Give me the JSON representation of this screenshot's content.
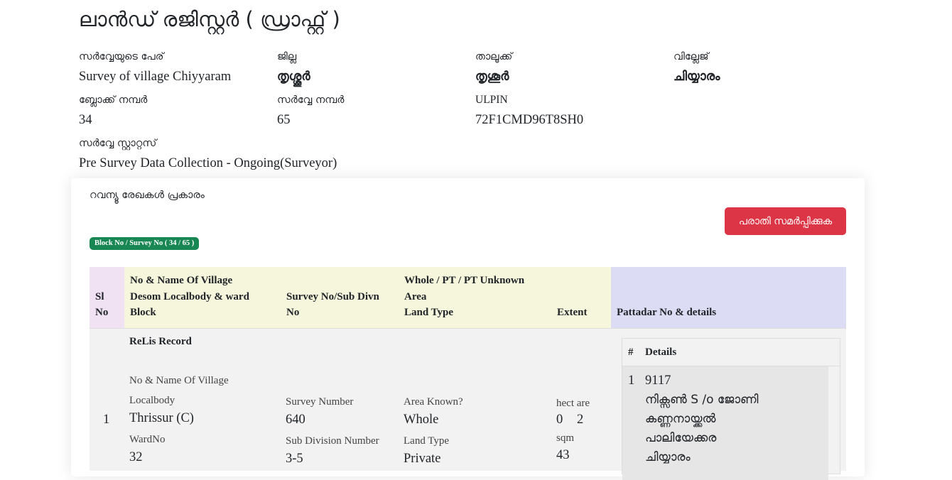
{
  "page": {
    "title": "ലാൻഡ് രജിസ്റ്റർ ( ഡ്രാഫ്റ്റ് )"
  },
  "meta": {
    "survey_name": {
      "label": "സർവ്വേയുടെ പേര്",
      "value": "Survey of village Chiyyaram"
    },
    "district": {
      "label": "ജില്ല",
      "value": "തൃശ്ശൂർ"
    },
    "taluk": {
      "label": "താലൂക്ക്",
      "value": "തൃശൂർ"
    },
    "village": {
      "label": "വില്ലേജ്",
      "value": "ചിയ്യാരം"
    },
    "block_no": {
      "label": "ബ്ലോക്ക് നമ്പർ",
      "value": "34"
    },
    "survey_no": {
      "label": "സർവ്വേ നമ്പർ",
      "value": "65"
    },
    "ulpin": {
      "label": "ULPIN",
      "value": "72F1CMD96T8SH0"
    },
    "survey_status": {
      "label": "സർവ്വേ സ്റ്റാറ്റസ്",
      "value": "Pre Survey Data Collection - Ongoing(Surveyor)"
    }
  },
  "card": {
    "title": "റവന്യൂ രേഖകൾ പ്രകാരം",
    "complaint_button": "പരാതി സമർപ്പിക്കുക",
    "badge": "Block No / Survey No ( 34 / 65 )"
  },
  "table": {
    "headers": {
      "sl": [
        "Sl",
        "No"
      ],
      "village": [
        "No & Name Of Village",
        "Desom Localbody & ward",
        "Block"
      ],
      "survey": [
        "Survey No/Sub Divn",
        "No"
      ],
      "area": [
        "Whole / PT / PT Unknown",
        "Area",
        "Land Type"
      ],
      "extent": "Extent",
      "pattadar": "Pattadar No & details"
    },
    "row": {
      "sl": "1",
      "section_title": "ReLis Record",
      "village_label": "No & Name Of Village",
      "localbody_label": "Localbody",
      "localbody_value": "Thrissur (C)",
      "ward_label": "WardNo",
      "ward_value": "32",
      "survey_number_label": "Survey Number",
      "survey_number_value": "640",
      "subdiv_label": "Sub Division Number",
      "subdiv_value": "3-5",
      "area_known_label": "Area Known?",
      "area_known_value": "Whole",
      "land_type_label": "Land Type",
      "land_type_value": "Private",
      "hect_label": "hect are",
      "hect_value": "0",
      "are_value": "2",
      "sqm_label": "sqm",
      "sqm_value": "43",
      "details_head_no": "#",
      "details_head": "Details",
      "detail_index": "1",
      "detail_lines": [
        "9117",
        "നിക്സൺ S /o ജോണി",
        "കണ്ണനായ്ക്കൽ",
        "പാലിയേക്കര",
        "ചിയ്യാരം"
      ]
    }
  }
}
